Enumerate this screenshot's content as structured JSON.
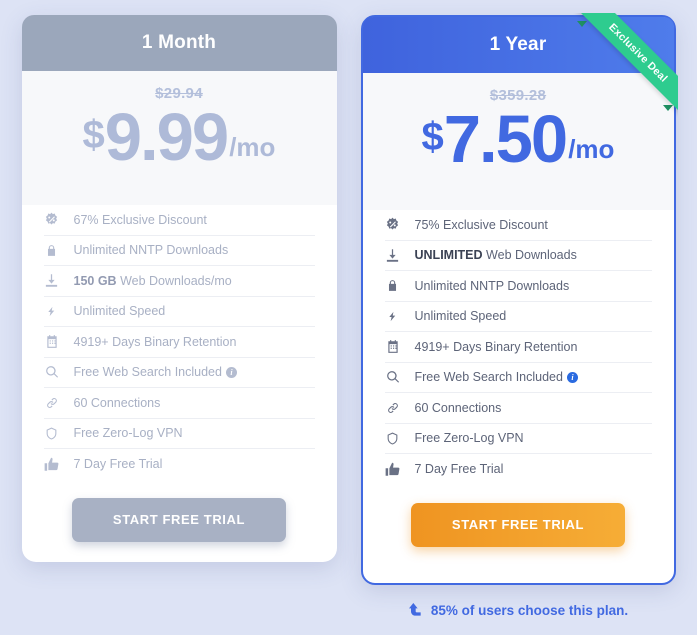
{
  "plans": [
    {
      "id": "one-month",
      "title": "1 Month",
      "price_old": "$29.94",
      "currency": "$",
      "amount": "9.99",
      "period": "/mo",
      "cta": "START FREE TRIAL",
      "features": [
        {
          "icon": "discount-burst-icon",
          "text": "67% Exclusive Discount",
          "bold_prefix": ""
        },
        {
          "icon": "lock-icon",
          "text": "Unlimited NNTP Downloads",
          "bold_prefix": ""
        },
        {
          "icon": "download-icon",
          "text": "Web Downloads/mo",
          "bold_prefix": "150 GB"
        },
        {
          "icon": "lightning-icon",
          "text": "Unlimited Speed",
          "bold_prefix": ""
        },
        {
          "icon": "calendar-icon",
          "text": "4919+ Days Binary Retention",
          "bold_prefix": ""
        },
        {
          "icon": "search-icon",
          "text": "Free Web Search Included",
          "bold_prefix": "",
          "info": "i"
        },
        {
          "icon": "link-icon",
          "text": "60 Connections",
          "bold_prefix": ""
        },
        {
          "icon": "shield-icon",
          "text": "Free Zero-Log VPN",
          "bold_prefix": ""
        },
        {
          "icon": "thumbs-up-icon",
          "text": "7 Day Free Trial",
          "bold_prefix": ""
        }
      ]
    },
    {
      "id": "one-year",
      "title": "1 Year",
      "ribbon": "Exclusive Deal",
      "price_old": "$359.28",
      "currency": "$",
      "amount": "7.50",
      "period": "/mo",
      "cta": "START FREE TRIAL",
      "note": "85% of users choose this plan.",
      "features": [
        {
          "icon": "discount-burst-icon",
          "text": "75% Exclusive Discount",
          "bold_prefix": ""
        },
        {
          "icon": "download-icon",
          "text": "Web Downloads",
          "bold_prefix": "UNLIMITED"
        },
        {
          "icon": "lock-icon",
          "text": "Unlimited NNTP Downloads",
          "bold_prefix": ""
        },
        {
          "icon": "lightning-icon",
          "text": "Unlimited Speed",
          "bold_prefix": ""
        },
        {
          "icon": "calendar-icon",
          "text": "4919+ Days Binary Retention",
          "bold_prefix": ""
        },
        {
          "icon": "search-icon",
          "text": "Free Web Search Included",
          "bold_prefix": "",
          "info": "i"
        },
        {
          "icon": "link-icon",
          "text": "60 Connections",
          "bold_prefix": ""
        },
        {
          "icon": "shield-icon",
          "text": "Free Zero-Log VPN",
          "bold_prefix": ""
        },
        {
          "icon": "thumbs-up-icon",
          "text": "7 Day Free Trial",
          "bold_prefix": ""
        }
      ]
    }
  ],
  "colors": {
    "page_background": "#dde3f5",
    "basic_header": "#9ba7bb",
    "featured_header": "#4169e1",
    "featured_price": "#4169e1",
    "basic_price": "#aebad8",
    "ribbon_green": "#2ecc8f",
    "cta_orange": "#f0a02a",
    "cta_grey": "#a8b1c4"
  }
}
